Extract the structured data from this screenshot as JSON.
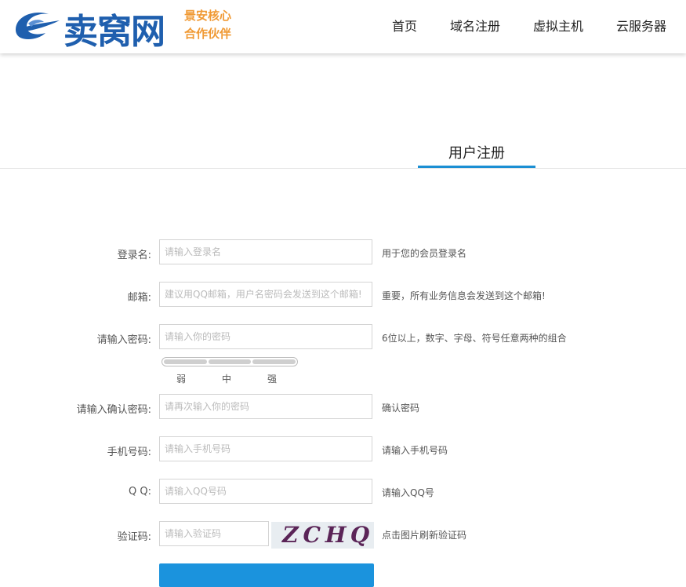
{
  "brand": {
    "name": "卖窝网",
    "slogan_line1": "景安核心",
    "slogan_line2": "合作伙伴"
  },
  "nav": [
    "首页",
    "域名注册",
    "虚拟主机",
    "云服务器"
  ],
  "tab": "用户注册",
  "form": {
    "login": {
      "label": "登录名:",
      "placeholder": "请输入登录名",
      "hint": "用于您的会员登录名"
    },
    "email": {
      "label": "邮箱:",
      "placeholder": "建议用QQ邮箱，用户名密码会发送到这个邮箱!",
      "hint": "重要，所有业务信息会发送到这个邮箱!"
    },
    "password": {
      "label": "请输入密码:",
      "placeholder": "请输入你的密码",
      "hint": "6位以上，数字、字母、符号任意两种的组合"
    },
    "strength": {
      "weak": "弱",
      "medium": "中",
      "strong": "强"
    },
    "confirm": {
      "label": "请输入确认密码:",
      "placeholder": "请再次输入你的密码",
      "hint": "确认密码"
    },
    "phone": {
      "label": "手机号码:",
      "placeholder": "请输入手机号码",
      "hint": "请输入手机号码"
    },
    "qq": {
      "label": "Q Q:",
      "placeholder": "请输入QQ号码",
      "hint": "请输入QQ号"
    },
    "captcha": {
      "label": "验证码:",
      "placeholder": "请输入验证码",
      "image_text": "ZCHQ",
      "hint": "点击图片刷新验证码"
    }
  },
  "colors": {
    "brand_blue": "#1f5fae",
    "slogan_orange": "#f09a35",
    "accent": "#1b8fd3"
  }
}
